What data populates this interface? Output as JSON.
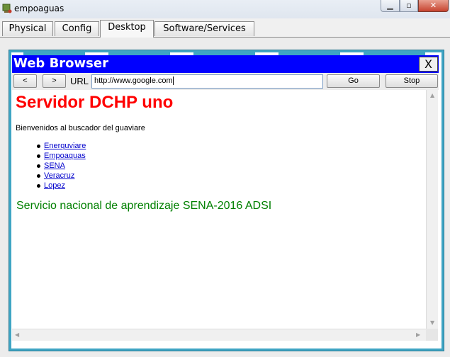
{
  "window": {
    "title": "empoaguas"
  },
  "tabs": [
    {
      "label": "Physical"
    },
    {
      "label": "Config"
    },
    {
      "label": "Desktop"
    },
    {
      "label": "Software/Services"
    }
  ],
  "active_tab": "Desktop",
  "browser": {
    "title": "Web Browser",
    "close_label": "X",
    "back_label": "<",
    "forward_label": ">",
    "url_label": "URL",
    "url_value": "http://www.google.com",
    "go_label": "Go",
    "stop_label": "Stop"
  },
  "page": {
    "heading": "Servidor DCHP uno",
    "intro": "Bienvenidos al buscador del guaviare",
    "links": [
      "Enerquviare",
      "Empoaquas",
      "SENA",
      "Veracruz",
      "Lopez"
    ],
    "footer": "Servicio nacional de aprendizaje SENA-2016 ADSI"
  },
  "colors": {
    "browser_bar": "#0000ff",
    "heading": "#ff0000",
    "footer": "#008000",
    "frame": "#3fa5c4"
  }
}
